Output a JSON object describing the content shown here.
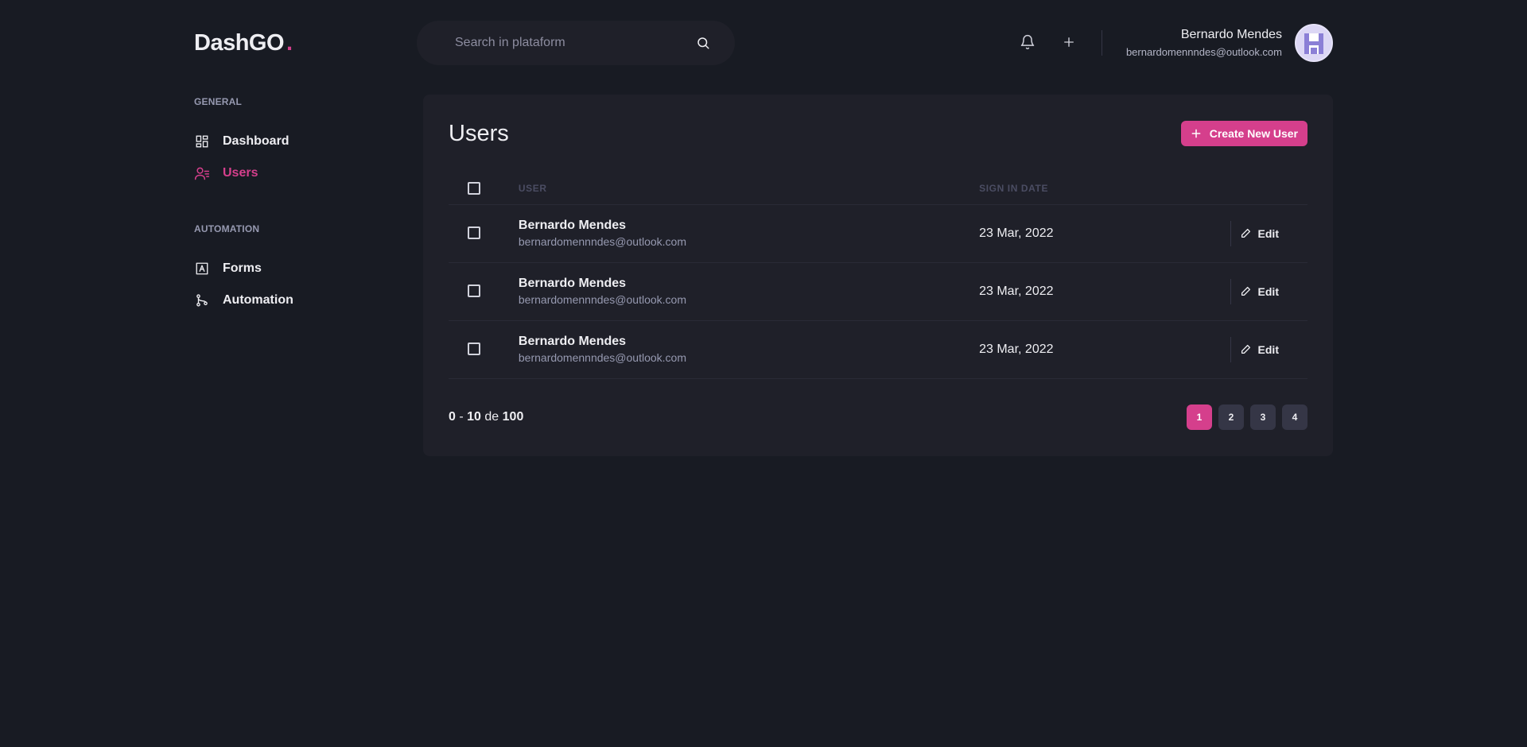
{
  "header": {
    "logo_text": "DashGO",
    "logo_dot": ".",
    "search_placeholder": "Search in plataform",
    "user_name": "Bernardo Mendes",
    "user_email": "bernardomennndes@outlook.com"
  },
  "sidebar": {
    "sections": [
      {
        "title": "GENERAL",
        "items": [
          {
            "label": "Dashboard",
            "icon": "dashboard-icon"
          },
          {
            "label": "Users",
            "icon": "users-icon",
            "active": true
          }
        ]
      },
      {
        "title": "AUTOMATION",
        "items": [
          {
            "label": "Forms",
            "icon": "forms-icon"
          },
          {
            "label": "Automation",
            "icon": "git-branch-icon"
          }
        ]
      }
    ]
  },
  "main": {
    "title": "Users",
    "create_label": "Create New User",
    "columns": {
      "user": "USER",
      "date": "SIGN IN DATE"
    },
    "rows": [
      {
        "name": "Bernardo Mendes",
        "email": "bernardomennndes@outlook.com",
        "date": "23 Mar, 2022",
        "action": "Edit"
      },
      {
        "name": "Bernardo Mendes",
        "email": "bernardomennndes@outlook.com",
        "date": "23 Mar, 2022",
        "action": "Edit"
      },
      {
        "name": "Bernardo Mendes",
        "email": "bernardomennndes@outlook.com",
        "date": "23 Mar, 2022",
        "action": "Edit"
      }
    ],
    "pagination": {
      "range_start": "0",
      "range_sep": "-",
      "range_end": "10",
      "range_word": "de",
      "total": "100",
      "pages": [
        "1",
        "2",
        "3",
        "4"
      ],
      "current": "1"
    }
  },
  "colors": {
    "background": "#181b23",
    "surface": "#1f2029",
    "accent": "#d53f8c",
    "muted": "#9699b0"
  }
}
